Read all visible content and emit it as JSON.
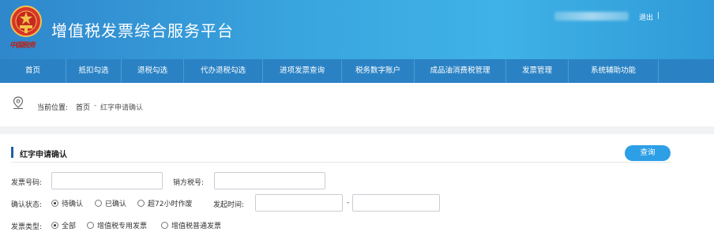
{
  "header": {
    "logo_text": "中国税务",
    "title": "增值税发票综合服务平台",
    "logout": "退出",
    "separator": "|"
  },
  "nav": {
    "items": [
      {
        "label": "首页"
      },
      {
        "label": "抵扣勾选"
      },
      {
        "label": "退税勾选"
      },
      {
        "label": "代办退税勾选"
      },
      {
        "label": "进项发票查询"
      },
      {
        "label": "税务数字账户"
      },
      {
        "label": "成品油消费税管理"
      },
      {
        "label": "发票管理"
      },
      {
        "label": "系统辅助功能"
      }
    ]
  },
  "breadcrumb": {
    "label": "当前位置:",
    "home": "首页",
    "separator": "-",
    "current": "红字申请确认"
  },
  "section": {
    "title": "红字申请确认",
    "query_button": "查询"
  },
  "form": {
    "invoice_no_label": "发票号码:",
    "invoice_no_value": "",
    "seller_tax_label": "销方税号:",
    "seller_tax_value": "",
    "status_label": "确认状态:",
    "status_options": [
      "待确认",
      "已确认",
      "超72小时作废"
    ],
    "status_selected": "待确认",
    "start_time_label": "发起时间:",
    "start_time_from": "",
    "range_sep": "-",
    "start_time_to": "",
    "type_label": "发票类型:",
    "type_options": [
      "全部",
      "增值税专用发票",
      "增值税普通发票"
    ],
    "type_selected": "全部"
  },
  "colors": {
    "header_blue": "#3aa7e0",
    "nav_blue": "#2a82c4",
    "button_blue": "#2d9fe6",
    "section_accent": "#1f5fa9"
  }
}
